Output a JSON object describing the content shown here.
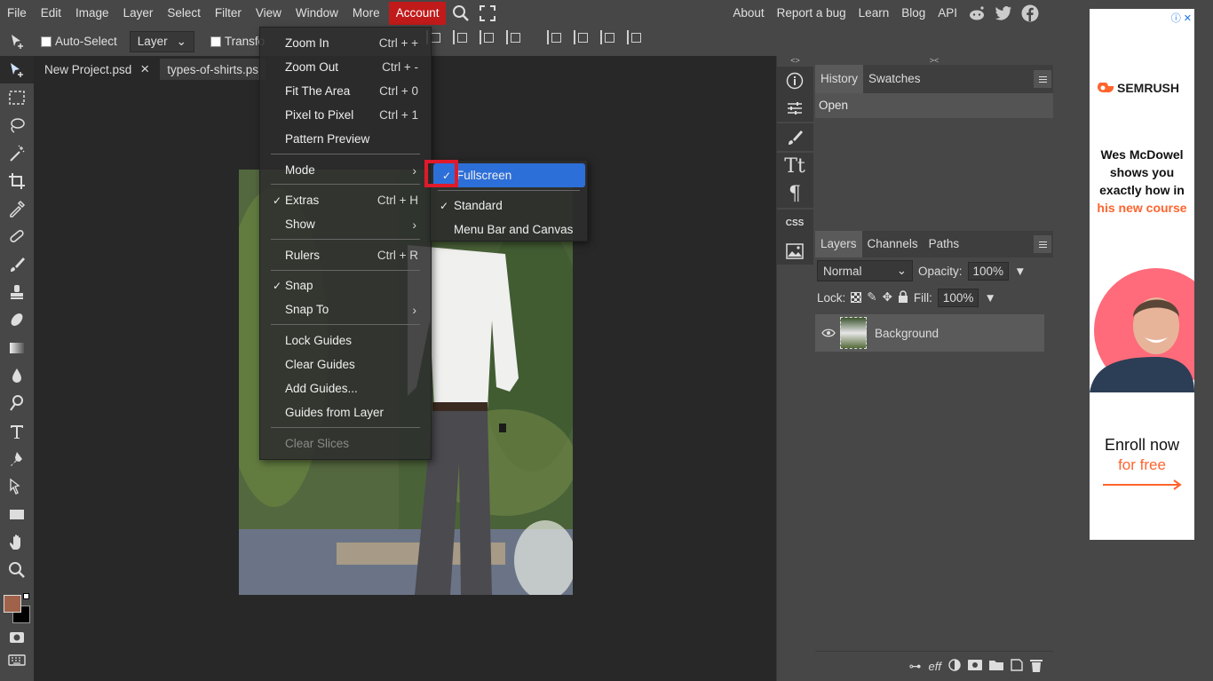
{
  "menubar": {
    "items": [
      "File",
      "Edit",
      "Image",
      "Layer",
      "Select",
      "Filter",
      "View",
      "Window",
      "More",
      "Account"
    ],
    "right_items": [
      "About",
      "Report a bug",
      "Learn",
      "Blog",
      "API"
    ]
  },
  "options": {
    "auto_select_label": "Auto-Select",
    "layer_select": "Layer",
    "transform_label": "Transfo"
  },
  "tabs": [
    {
      "label": "New Project.psd",
      "close": "×"
    },
    {
      "label": "types-of-shirts.ps"
    }
  ],
  "view_menu": {
    "items": [
      {
        "label": "Zoom In",
        "shortcut": "Ctrl + +"
      },
      {
        "label": "Zoom Out",
        "shortcut": "Ctrl + -"
      },
      {
        "label": "Fit The Area",
        "shortcut": "Ctrl + 0"
      },
      {
        "label": "Pixel to Pixel",
        "shortcut": "Ctrl + 1"
      },
      {
        "label": "Pattern Preview",
        "shortcut": ""
      },
      {
        "label": "Mode",
        "arrow": "›"
      },
      {
        "label": "Extras",
        "shortcut": "Ctrl + H",
        "check": "✓"
      },
      {
        "label": "Show",
        "arrow": "›"
      },
      {
        "label": "Rulers",
        "shortcut": "Ctrl + R"
      },
      {
        "label": "Snap",
        "check": "✓"
      },
      {
        "label": "Snap To",
        "arrow": "›"
      },
      {
        "label": "Lock Guides"
      },
      {
        "label": "Clear Guides"
      },
      {
        "label": "Add Guides..."
      },
      {
        "label": "Guides from Layer"
      },
      {
        "label": "Clear Slices"
      }
    ]
  },
  "mode_submenu": {
    "items": [
      {
        "label": "Fullscreen",
        "check": "✓"
      },
      {
        "label": "Standard",
        "check": "✓"
      },
      {
        "label": "Menu Bar and Canvas",
        "check": ""
      }
    ]
  },
  "history_panel": {
    "tabs": [
      "History",
      "Swatches"
    ],
    "rows": [
      "Open"
    ]
  },
  "layers_panel": {
    "tabs": [
      "Layers",
      "Channels",
      "Paths"
    ],
    "blend_mode": "Normal",
    "opacity_label": "Opacity:",
    "opacity_value": "100%",
    "lock_label": "Lock:",
    "fill_label": "Fill:",
    "fill_value": "100%",
    "layers": [
      {
        "name": "Background"
      }
    ]
  },
  "ad": {
    "info": "ⓘ ✕",
    "brand": "SEMRUSH",
    "headline_1": "Wes McDowel shows you exactly how in",
    "headline_2": "his new course",
    "enroll_1": "Enroll now",
    "enroll_2": "for free"
  },
  "colors": {
    "account_active": "#c11a1a",
    "selection_blue": "#2d6fd8",
    "highlight_red": "#e01a2a",
    "foreground_swatch": "#a0624a",
    "semrush_orange": "#ff642d"
  }
}
